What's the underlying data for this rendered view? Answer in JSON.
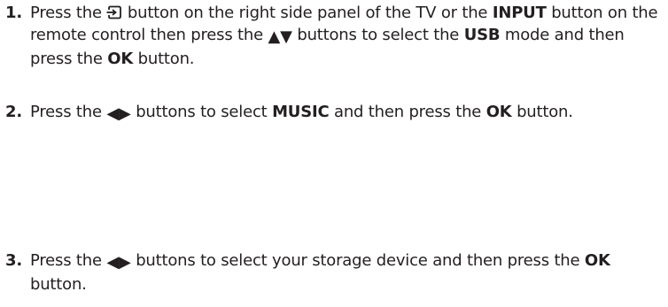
{
  "steps": [
    {
      "number": "1.",
      "segments": {
        "s1": "Press the ",
        "s2": " button on the right side panel of the TV or the ",
        "s3": "INPUT",
        "s4": " button on the remote control then press the ",
        "s5": " buttons to select the ",
        "s6": "USB",
        "s7": " mode and then press the ",
        "s8": "OK",
        "s9": " button."
      },
      "icons": {
        "input": "input-source-icon",
        "up": "▲",
        "down": "▼"
      }
    },
    {
      "number": "2.",
      "segments": {
        "s1": "Press the ",
        "s2": " buttons to select ",
        "s3": "MUSIC",
        "s4": " and then press the ",
        "s5": "OK",
        "s6": " button."
      },
      "icons": {
        "left": "◀",
        "right": "▶"
      }
    },
    {
      "number": "3.",
      "segments": {
        "s1": "Press the ",
        "s2": " buttons to select your storage device and then press the ",
        "s3": "OK",
        "s4": " button."
      },
      "icons": {
        "left": "◀",
        "right": "▶"
      }
    }
  ]
}
